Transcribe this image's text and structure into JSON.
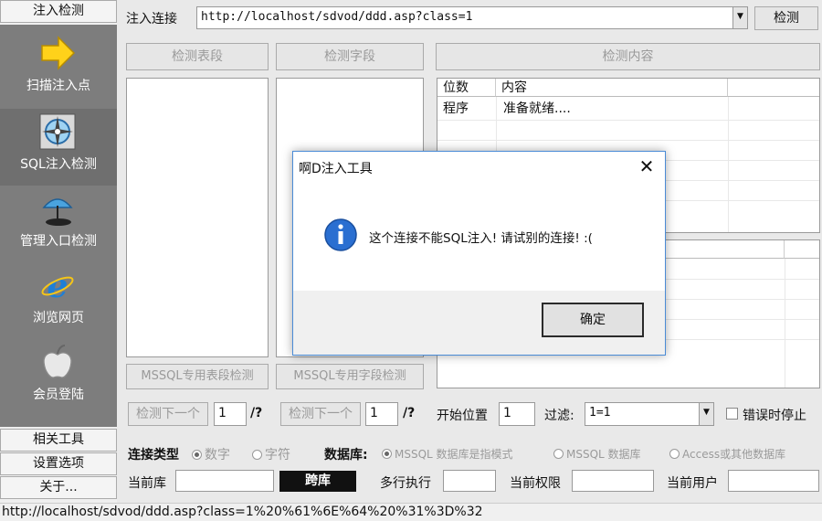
{
  "sidebar": {
    "top_tab": "注入检测",
    "items": [
      {
        "label": "扫描注入点",
        "icon": "arrow-right-icon"
      },
      {
        "label": "SQL注入检测",
        "icon": "compass-icon"
      },
      {
        "label": "管理入口检测",
        "icon": "umbrella-icon"
      },
      {
        "label": "浏览网页",
        "icon": "ie-browser-icon"
      },
      {
        "label": "会员登陆",
        "icon": "apple-icon"
      }
    ],
    "bottom_tabs": [
      "相关工具",
      "设置选项",
      "关于..."
    ]
  },
  "top": {
    "url_label": "注入连接",
    "url_value": "http://localhost/sdvod/ddd.asp?class=1",
    "check_button": "检测"
  },
  "buttons": {
    "detect_table": "检测表段",
    "detect_field": "检测字段",
    "detect_content": "检测内容",
    "mssql_table": "MSSQL专用表段检测",
    "mssql_field": "MSSQL专用字段检测",
    "next1": "检测下一个",
    "next2": "检测下一个"
  },
  "results_table": {
    "columns": [
      "位数",
      "内容"
    ],
    "rows": [
      [
        "程序",
        "准备就绪...."
      ]
    ]
  },
  "controls": {
    "page1": "1",
    "slash1": "/?",
    "page2": "1",
    "slash2": "/?",
    "start_label": "开始位置",
    "start_value": "1",
    "filter_label": "过滤:",
    "filter_value": "1=1",
    "stop_on_error": "错误时停止"
  },
  "options": {
    "conn_type_label": "连接类型",
    "conn_number": "数字",
    "conn_char": "字符",
    "db_label": "数据库:",
    "db_mssql_dba": "MSSQL 数据库是指模式",
    "db_mssql": "MSSQL 数据库",
    "db_access": "Access或其他数据库",
    "current_db_label": "当前库",
    "cross_db_button": "跨库",
    "multi_exec_label": "多行执行",
    "current_perm_label": "当前权限",
    "current_user_label": "当前用户"
  },
  "status_bar": "http://localhost/sdvod/ddd.asp?class=1%20%61%6E%64%20%31%3D%32",
  "dialog": {
    "title": "啊D注入工具",
    "message": "这个连接不能SQL注入! 请试别的连接! :(",
    "ok": "确定",
    "icon": "info-icon"
  }
}
